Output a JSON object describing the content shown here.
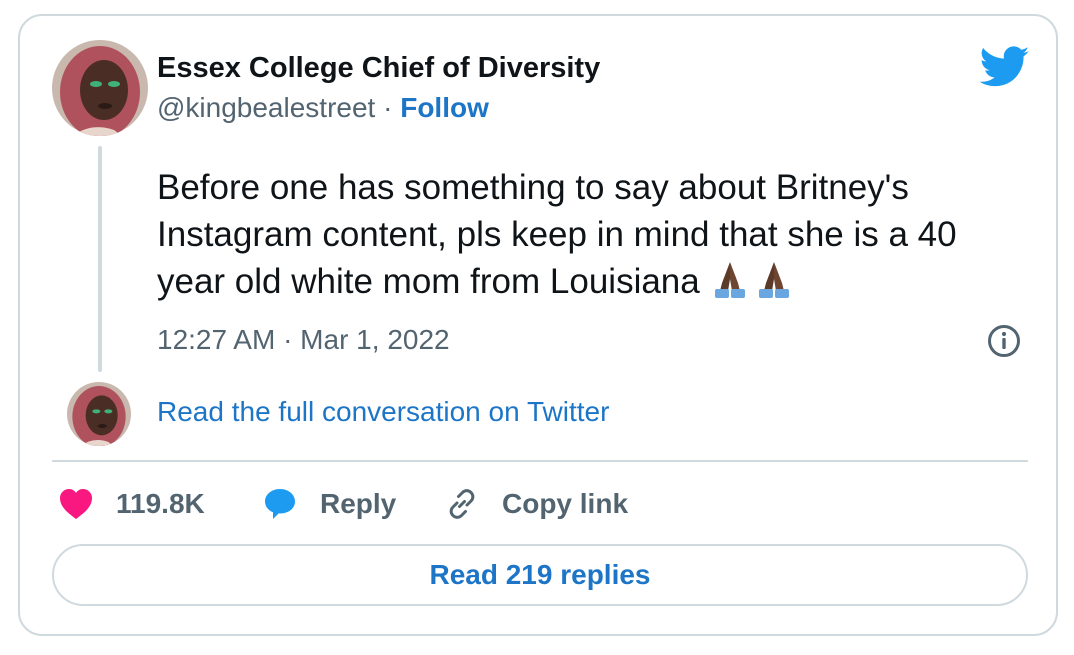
{
  "author": {
    "name": "Essex College Chief of Diversity",
    "handle": "@kingbealestreet",
    "separator": " · ",
    "follow_label": "Follow"
  },
  "tweet": {
    "text": "Before one has something to say about Britney's Instagram content, pls keep in mind that she is a 40 year old white mom from Louisiana",
    "emoji": [
      "folded-hands-dark-skin",
      "folded-hands-dark-skin"
    ],
    "timestamp": "12:27 AM · Mar 1, 2022"
  },
  "conversation_link": "Read the full conversation on Twitter",
  "actions": {
    "like_count": "119.8K",
    "reply_label": "Reply",
    "copy_link_label": "Copy link"
  },
  "read_replies_label": "Read 219 replies",
  "icons": {
    "brand": "twitter-bird-icon",
    "info": "info-icon",
    "like": "heart-icon",
    "reply": "speech-bubble-icon",
    "copy": "link-icon"
  },
  "colors": {
    "brand_blue": "#1d9bf0",
    "link_blue": "#1d75c7",
    "like_pink": "#f91880",
    "text_primary": "#0f1419",
    "text_secondary": "#536471",
    "border": "#cfd9de"
  }
}
